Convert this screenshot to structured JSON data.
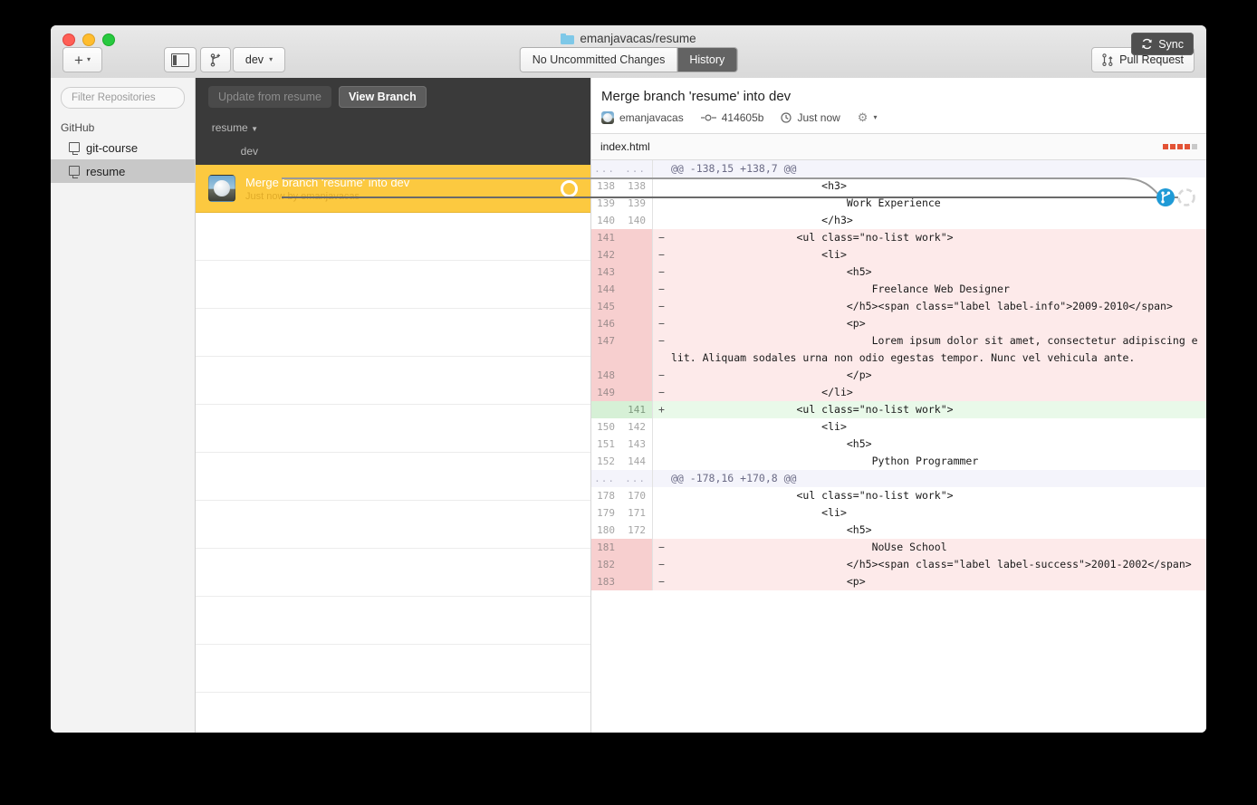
{
  "window": {
    "title": "emanjavacas/resume",
    "folder_icon": "folder-icon"
  },
  "toolbar": {
    "add_label": "+",
    "add_caret": "⌄",
    "sidebar_toggle_icon": "sidebar-toggle-icon",
    "create_branch_icon": "create-branch-icon",
    "branch_name": "dev",
    "branch_caret": "⌄",
    "tabs": [
      {
        "label": "No Uncommitted Changes",
        "selected": false
      },
      {
        "label": "History",
        "selected": true
      }
    ],
    "pull_request_label": "Pull Request",
    "pull_request_icon": "pull-request-icon"
  },
  "sidebar": {
    "filter_placeholder": "Filter Repositories",
    "section_label": "GitHub",
    "repos": [
      {
        "name": "git-course",
        "selected": false,
        "icon": "repository-icon"
      },
      {
        "name": "resume",
        "selected": true,
        "icon": "repository-icon"
      }
    ]
  },
  "actionbar": {
    "update_label": "Update from resume",
    "view_branch_label": "View Branch",
    "sync_label": "Sync",
    "sync_icon": "sync-icon"
  },
  "graph": {
    "branches": [
      {
        "label": "resume",
        "caret": "▼"
      },
      {
        "label": "dev",
        "caret": ""
      }
    ],
    "merge_node_icon": "branch-merge-icon",
    "head_node_icon": "head-commit-icon"
  },
  "commit_list": {
    "selected_commit": {
      "title": "Merge branch 'resume' into dev",
      "subtitle": "Just now by emanjavacas",
      "avatar": "user-avatar",
      "status_icon": "commit-ring-icon"
    },
    "empty_rows": 11
  },
  "detail": {
    "title": "Merge branch 'resume' into dev",
    "author": "emanjavacas",
    "sha": "414605b",
    "sha_icon": "commit-sha-icon",
    "time": "Just now",
    "time_icon": "clock-icon",
    "gear_icon": "gear-icon",
    "gear_caret": "▾",
    "avatar": "user-avatar-small",
    "file": {
      "name": "index.html",
      "blocks": [
        "r",
        "r",
        "r",
        "r",
        "g"
      ]
    }
  },
  "diff": {
    "lines": [
      {
        "type": "hunk",
        "old": "...",
        "new": "...",
        "sign": "",
        "code": "@@ -138,15 +138,7 @@"
      },
      {
        "type": "ctx",
        "old": "138",
        "new": "138",
        "sign": "",
        "code": "                        <h3>"
      },
      {
        "type": "ctx",
        "old": "139",
        "new": "139",
        "sign": "",
        "code": "                            Work Experience"
      },
      {
        "type": "ctx",
        "old": "140",
        "new": "140",
        "sign": "",
        "code": "                        </h3>"
      },
      {
        "type": "del",
        "old": "141",
        "new": "",
        "sign": "−",
        "code": "                    <ul class=\"no-list work\">"
      },
      {
        "type": "del",
        "old": "142",
        "new": "",
        "sign": "−",
        "code": "                        <li>"
      },
      {
        "type": "del",
        "old": "143",
        "new": "",
        "sign": "−",
        "code": "                            <h5>"
      },
      {
        "type": "del",
        "old": "144",
        "new": "",
        "sign": "−",
        "code": "                                Freelance Web Designer"
      },
      {
        "type": "del",
        "old": "145",
        "new": "",
        "sign": "−",
        "code": "                            </h5><span class=\"label label-info\">2009-2010</span>"
      },
      {
        "type": "del",
        "old": "146",
        "new": "",
        "sign": "−",
        "code": "                            <p>"
      },
      {
        "type": "del",
        "old": "147",
        "new": "",
        "sign": "−",
        "code": "                                Lorem ipsum dolor sit amet, consectetur adipiscing elit. Aliquam sodales urna non odio egestas tempor. Nunc vel vehicula ante."
      },
      {
        "type": "del",
        "old": "148",
        "new": "",
        "sign": "−",
        "code": "                            </p>"
      },
      {
        "type": "del",
        "old": "149",
        "new": "",
        "sign": "−",
        "code": "                        </li>"
      },
      {
        "type": "add",
        "old": "",
        "new": "141",
        "sign": "+",
        "code": "                    <ul class=\"no-list work\">"
      },
      {
        "type": "ctx",
        "old": "150",
        "new": "142",
        "sign": "",
        "code": "                        <li>"
      },
      {
        "type": "ctx",
        "old": "151",
        "new": "143",
        "sign": "",
        "code": "                            <h5>"
      },
      {
        "type": "ctx",
        "old": "152",
        "new": "144",
        "sign": "",
        "code": "                                Python Programmer"
      },
      {
        "type": "hunk",
        "old": "...",
        "new": "...",
        "sign": "",
        "code": "@@ -178,16 +170,8 @@"
      },
      {
        "type": "ctx",
        "old": "178",
        "new": "170",
        "sign": "",
        "code": "                    <ul class=\"no-list work\">"
      },
      {
        "type": "ctx",
        "old": "179",
        "new": "171",
        "sign": "",
        "code": "                        <li>"
      },
      {
        "type": "ctx",
        "old": "180",
        "new": "172",
        "sign": "",
        "code": "                            <h5>"
      },
      {
        "type": "del",
        "old": "181",
        "new": "",
        "sign": "−",
        "code": "                                NoUse School"
      },
      {
        "type": "del",
        "old": "182",
        "new": "",
        "sign": "−",
        "code": "                            </h5><span class=\"label label-success\">2001-2002</span>"
      },
      {
        "type": "del",
        "old": "183",
        "new": "",
        "sign": "−",
        "code": "                            <p>"
      }
    ]
  }
}
